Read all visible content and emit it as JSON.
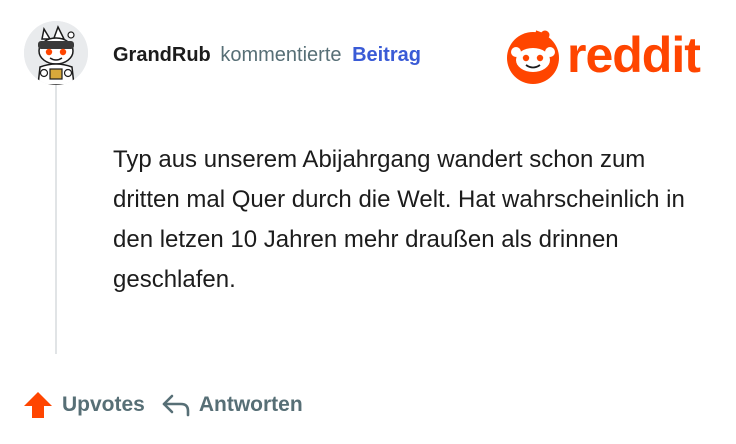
{
  "comment": {
    "username": "GrandRub",
    "action_text": "kommentierte",
    "target_link": "Beitrag",
    "body": "Typ aus unserem Abijahrgang wandert schon zum dritten mal Quer durch die Welt. Hat wahrscheinlich in den letzen 10 Jahren mehr draußen als drinnen geschlafen.",
    "avatar_icon": "snoo-avatar-icon"
  },
  "brand": {
    "name": "reddit",
    "color": "#ff4500",
    "icon": "snoo-icon"
  },
  "actions": {
    "upvote_label": "Upvotes",
    "reply_label": "Antworten"
  },
  "colors": {
    "upvote_arrow": "#ff4500",
    "link": "#3a5bd6",
    "muted": "#576f76",
    "text": "#1c1c1c"
  }
}
